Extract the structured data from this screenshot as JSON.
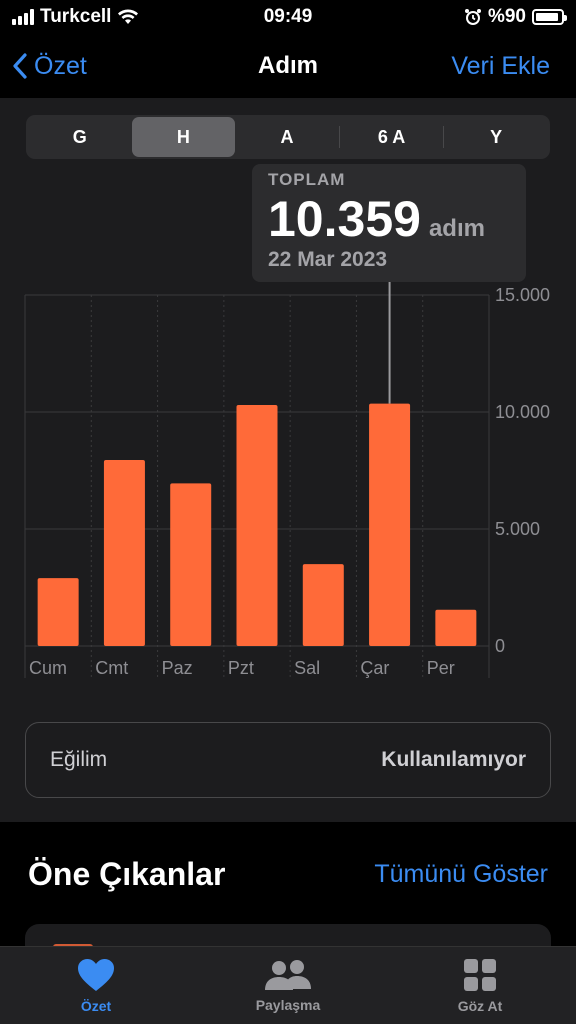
{
  "status_bar": {
    "carrier": "Turkcell",
    "time": "09:49",
    "battery_text": "%90",
    "battery_level": 0.9
  },
  "nav": {
    "back_label": "Özet",
    "title": "Adım",
    "add_label": "Veri Ekle"
  },
  "segments": {
    "items": [
      "G",
      "H",
      "A",
      "6 A",
      "Y"
    ],
    "selected": "H"
  },
  "tooltip": {
    "label": "TOPLAM",
    "value": "10.359",
    "unit": "adım",
    "date": "22 Mar 2023"
  },
  "chart_data": {
    "type": "bar",
    "categories": [
      "Cum",
      "Cmt",
      "Paz",
      "Pzt",
      "Sal",
      "Çar",
      "Per"
    ],
    "values": [
      2900,
      7950,
      6950,
      10300,
      3500,
      10359,
      1550
    ],
    "y_tick_labels": [
      "15.000",
      "10.000",
      "5.000",
      "0"
    ],
    "y_tick_values": [
      15000,
      10000,
      5000,
      0
    ],
    "ylim": [
      0,
      15000
    ],
    "selected_index": 5,
    "bar_color": "#ff6a39",
    "grid": true
  },
  "trend": {
    "label": "Eğilim",
    "value": "Kullanılamıyor"
  },
  "highlights": {
    "heading": "Öne Çıkanlar",
    "show_all": "Tümünü Göster"
  },
  "tabbar": {
    "items": [
      {
        "label": "Özet",
        "icon": "heart-icon",
        "active": true
      },
      {
        "label": "Paylaşma",
        "icon": "people-icon",
        "active": false
      },
      {
        "label": "Göz At",
        "icon": "grid-icon",
        "active": false
      }
    ]
  },
  "colors": {
    "accent": "#3b8cf2",
    "bar": "#ff6a39",
    "card_bg": "#1c1c1e"
  }
}
